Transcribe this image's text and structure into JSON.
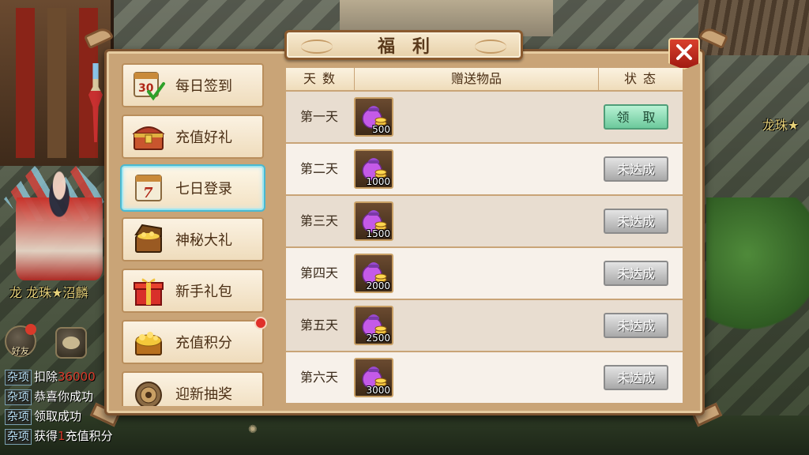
{
  "scene": {
    "player_name_left": "龙 龙珠★沼麟",
    "player_name_right": "龙珠★",
    "friend_label": "好友",
    "chat": [
      {
        "tag": "杂项",
        "pre": "扣除",
        "hl": "36000",
        "post": ""
      },
      {
        "tag": "杂项",
        "pre": "恭喜你成功",
        "hl": "",
        "post": ""
      },
      {
        "tag": "杂项",
        "pre": "领取成功",
        "hl": "",
        "post": ""
      },
      {
        "tag": "杂项",
        "pre": "获得",
        "hl": "1",
        "post": "充值积分"
      }
    ]
  },
  "panel": {
    "title": "福利",
    "close_icon": "close-x-icon"
  },
  "menu": [
    {
      "label": "每日签到",
      "icon": "calendar-30-check-icon",
      "badge": false
    },
    {
      "label": "充值好礼",
      "icon": "treasure-chest-icon",
      "badge": false
    },
    {
      "label": "七日登录",
      "icon": "calendar-7-icon",
      "badge": false,
      "active": true
    },
    {
      "label": "神秘大礼",
      "icon": "gold-chest-icon",
      "badge": false
    },
    {
      "label": "新手礼包",
      "icon": "red-gift-box-icon",
      "badge": false
    },
    {
      "label": "充值积分",
      "icon": "gold-treasure-icon",
      "badge": true
    },
    {
      "label": "迎新抽奖",
      "icon": "lottery-wheel-icon",
      "badge": false
    }
  ],
  "table": {
    "headers": {
      "day": "天数",
      "item": "赠送物品",
      "state": "状态"
    },
    "rows": [
      {
        "day": "第一天",
        "qty": "500",
        "state": "领 取",
        "claimable": true
      },
      {
        "day": "第二天",
        "qty": "1000",
        "state": "未达成",
        "claimable": false
      },
      {
        "day": "第三天",
        "qty": "1500",
        "state": "未达成",
        "claimable": false
      },
      {
        "day": "第四天",
        "qty": "2000",
        "state": "未达成",
        "claimable": false
      },
      {
        "day": "第五天",
        "qty": "2500",
        "state": "未达成",
        "claimable": false
      },
      {
        "day": "第六天",
        "qty": "3000",
        "state": "未达成",
        "claimable": false
      }
    ],
    "reward_icon": "coin-pouch-icon"
  },
  "colors": {
    "panel_border": "#7d5431",
    "claim_button": "#6cc99c",
    "locked_button": "#a9a9a9",
    "close_button": "#c02a1c",
    "active_tab_glow": "#4ab8d0"
  }
}
